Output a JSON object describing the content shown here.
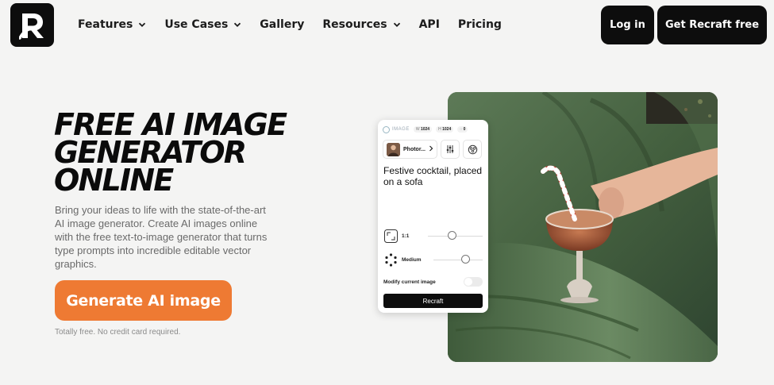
{
  "header": {
    "logo_icon": "recraft-logo-icon",
    "nav": [
      {
        "label": "Features",
        "has_dropdown": true
      },
      {
        "label": "Use Cases",
        "has_dropdown": true
      },
      {
        "label": "Gallery",
        "has_dropdown": false
      },
      {
        "label": "Resources",
        "has_dropdown": true
      },
      {
        "label": "API",
        "has_dropdown": false
      },
      {
        "label": "Pricing",
        "has_dropdown": false
      }
    ],
    "login_label": "Log in",
    "signup_label": "Get Recraft free"
  },
  "hero": {
    "title_lines": [
      "FREE AI IMAGE",
      "GENERATOR",
      "ONLINE"
    ],
    "description": "Bring your ideas to life with the state-of-the-art AI image generator. Create AI images online with the free text-to-image generator that turns type prompts into incredible editable vector graphics.",
    "cta_label": "Generate AI image",
    "cta_note": "Totally free. No credit card required.",
    "cta_color": "#ee7a33"
  },
  "card": {
    "brand_label": "IMAGE",
    "width_label": "W",
    "width_value": "1024",
    "height_label": "H",
    "height_value": "1024",
    "count_value": "0",
    "style_label": "Photor...",
    "prompt": "Festive cocktail, placed on a sofa",
    "ratio_label": "1:1",
    "ratio_slider_value": 0.45,
    "detail_label": "Medium",
    "detail_slider_value": 0.7,
    "modify_label": "Modify current image",
    "modify_enabled": false,
    "submit_label": "Recraft"
  },
  "hero_image": {
    "description_icon": "cocktail-on-sofa-photo"
  }
}
